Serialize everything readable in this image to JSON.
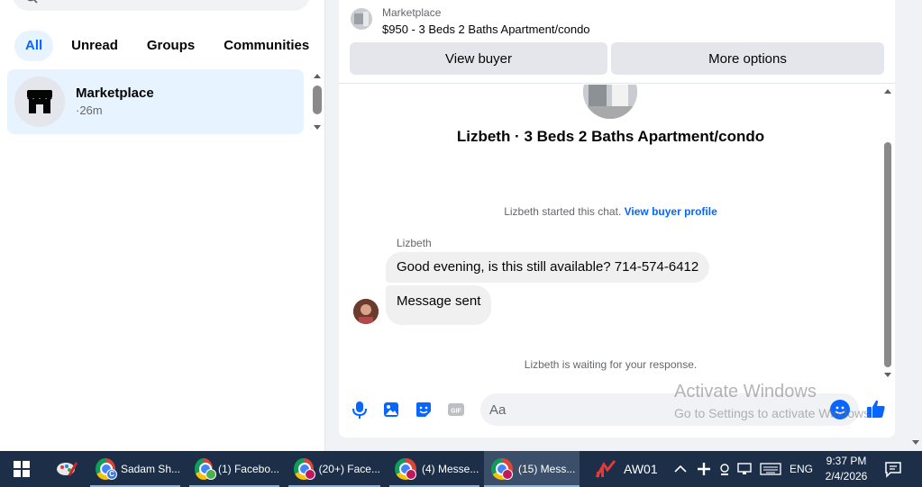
{
  "left": {
    "filters": [
      "All",
      "Unread",
      "Groups",
      "Communities"
    ],
    "active_filter": "All",
    "chat": {
      "name": "Marketplace",
      "time": "·26m"
    }
  },
  "context": {
    "source": "Marketplace",
    "title": "$950 - 3 Beds 2 Baths Apartment/condo",
    "view_buyer": "View buyer",
    "more_options": "More options"
  },
  "thread": {
    "listing_title": "Lizbeth · 3 Beds 2 Baths Apartment/condo",
    "started_text": "Lizbeth started this chat.",
    "view_profile": "View buyer profile",
    "sender": "Lizbeth",
    "messages": [
      "Good evening, is this still available? 714-574-6412",
      "Message sent"
    ],
    "waiting": "Lizbeth is waiting for your response."
  },
  "composer": {
    "placeholder": "Aa"
  },
  "watermark": {
    "line1": "Activate Windows",
    "line2": "Go to Settings to activate Windows."
  },
  "taskbar": {
    "apps": [
      {
        "label": "Sadam Sh...",
        "badge": "C",
        "badge_color": "#3b7ddd"
      },
      {
        "label": "(1) Facebo...",
        "badge": "",
        "badge_color": "#4caf50"
      },
      {
        "label": "(20+) Face...",
        "badge": "",
        "badge_color": "#c2185b"
      },
      {
        "label": "(4) Messe...",
        "badge": "",
        "badge_color": "#c2185b"
      },
      {
        "label": "(15) Mess...",
        "badge": "",
        "badge_color": "#c2185b"
      }
    ],
    "tray_app": "AW01",
    "language": "ENG",
    "time": "9:37 PM",
    "date": "2/4/2026"
  },
  "colors": {
    "accent": "#0866ff",
    "taskbar": "#1c2e48"
  }
}
